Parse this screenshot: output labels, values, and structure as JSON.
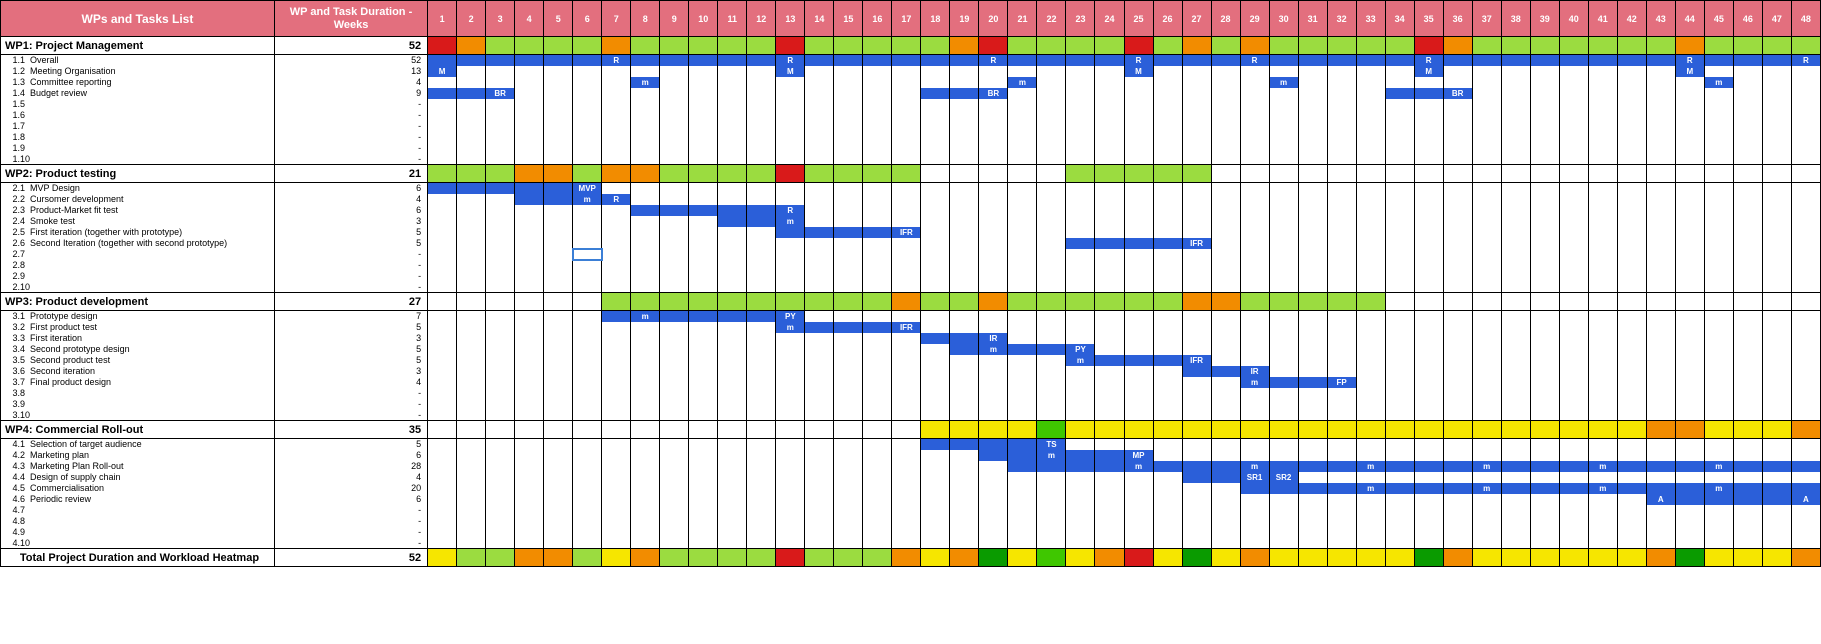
{
  "headers": {
    "col1": "WPs and Tasks List",
    "col2": "WP and Task Duration - Weeks"
  },
  "weeks": 48,
  "wp_headers": [
    {
      "id": "WP1",
      "title": "WP1:    Project Management",
      "dur": "52",
      "heat": [
        "red",
        "orange",
        "lgreen",
        "lgreen",
        "lgreen",
        "lgreen",
        "orange",
        "lgreen",
        "lgreen",
        "lgreen",
        "lgreen",
        "lgreen",
        "red",
        "lgreen",
        "lgreen",
        "lgreen",
        "lgreen",
        "lgreen",
        "orange",
        "red",
        "lgreen",
        "lgreen",
        "lgreen",
        "lgreen",
        "red",
        "lgreen",
        "orange",
        "lgreen",
        "orange",
        "lgreen",
        "lgreen",
        "lgreen",
        "lgreen",
        "lgreen",
        "red",
        "orange",
        "lgreen",
        "lgreen",
        "lgreen",
        "lgreen",
        "lgreen",
        "lgreen",
        "lgreen",
        "orange",
        "lgreen",
        "lgreen",
        "lgreen",
        "lgreen"
      ]
    },
    {
      "id": "WP2",
      "title": "WP2:    Product testing",
      "dur": "21",
      "heat": [
        "lgreen",
        "lgreen",
        "lgreen",
        "orange",
        "orange",
        "lgreen",
        "orange",
        "orange",
        "lgreen",
        "lgreen",
        "lgreen",
        "lgreen",
        "red",
        "lgreen",
        "lgreen",
        "lgreen",
        "lgreen",
        "",
        "",
        "",
        "",
        "",
        "lgreen",
        "lgreen",
        "lgreen",
        "lgreen",
        "lgreen",
        "",
        "",
        "",
        "",
        "",
        "",
        "",
        "",
        "",
        "",
        "",
        "",
        "",
        "",
        "",
        "",
        "",
        "",
        "",
        "",
        ""
      ]
    },
    {
      "id": "WP3",
      "title": "WP3:    Product development",
      "dur": "27",
      "heat": [
        "",
        "",
        "",
        "",
        "",
        "",
        "lgreen",
        "lgreen",
        "lgreen",
        "lgreen",
        "lgreen",
        "lgreen",
        "lgreen",
        "lgreen",
        "lgreen",
        "lgreen",
        "orange",
        "lgreen",
        "lgreen",
        "orange",
        "lgreen",
        "lgreen",
        "lgreen",
        "lgreen",
        "lgreen",
        "lgreen",
        "orange",
        "orange",
        "lgreen",
        "lgreen",
        "lgreen",
        "lgreen",
        "lgreen",
        "",
        "",
        "",
        "",
        "",
        "",
        "",
        "",
        "",
        "",
        "",
        "",
        "",
        "",
        ""
      ]
    },
    {
      "id": "WP4",
      "title": "WP4:    Commercial Roll-out",
      "dur": "35",
      "heat": [
        "",
        "",
        "",
        "",
        "",
        "",
        "",
        "",
        "",
        "",
        "",
        "",
        "",
        "",
        "",
        "",
        "",
        "yellow",
        "yellow",
        "yellow",
        "yellow",
        "green",
        "yellow",
        "yellow",
        "yellow",
        "yellow",
        "yellow",
        "yellow",
        "yellow",
        "yellow",
        "yellow",
        "yellow",
        "yellow",
        "yellow",
        "yellow",
        "yellow",
        "yellow",
        "yellow",
        "yellow",
        "yellow",
        "yellow",
        "yellow",
        "orange",
        "orange",
        "yellow",
        "yellow",
        "yellow",
        "orange"
      ]
    }
  ],
  "chart_data": {
    "type": "gantt-heatmap",
    "title": "Project Plan Gantt with Workload Heatmap",
    "xlabel": "Weeks",
    "x_range": [
      1,
      48
    ],
    "total_row": {
      "label": "Total Project Duration and Workload Heatmap",
      "dur": "52",
      "heat": [
        "yellow",
        "lgreen",
        "lgreen",
        "orange",
        "orange",
        "lgreen",
        "yellow",
        "orange",
        "lgreen",
        "lgreen",
        "lgreen",
        "lgreen",
        "red",
        "lgreen",
        "lgreen",
        "lgreen",
        "orange",
        "yellow",
        "orange",
        "bgreen",
        "yellow",
        "green",
        "yellow",
        "orange",
        "red",
        "yellow",
        "bgreen",
        "yellow",
        "orange",
        "yellow",
        "yellow",
        "yellow",
        "yellow",
        "yellow",
        "bgreen",
        "orange",
        "yellow",
        "yellow",
        "yellow",
        "yellow",
        "yellow",
        "yellow",
        "orange",
        "bgreen",
        "yellow",
        "yellow",
        "yellow",
        "orange"
      ]
    },
    "tasks": [
      {
        "wp": "WP1",
        "id": "1.1",
        "name": "Overall",
        "dur": "52",
        "bars": [
          {
            "s": 1,
            "e": 48
          }
        ],
        "labels": {
          "7": "R",
          "13": "R",
          "20": "R",
          "25": "R",
          "29": "R",
          "35": "R",
          "44": "R",
          "48": "R"
        }
      },
      {
        "wp": "WP1",
        "id": "1.2",
        "name": "Meeting Organisation",
        "dur": "13",
        "bars": [
          {
            "s": 1,
            "e": 1
          },
          {
            "s": 13,
            "e": 13
          },
          {
            "s": 25,
            "e": 25
          },
          {
            "s": 35,
            "e": 35
          },
          {
            "s": 44,
            "e": 44
          }
        ],
        "labels": {
          "1": "M",
          "13": "M",
          "25": "M",
          "35": "M",
          "44": "M"
        }
      },
      {
        "wp": "WP1",
        "id": "1.3",
        "name": "Committee reporting",
        "dur": "4",
        "bars": [
          {
            "s": 8,
            "e": 8
          },
          {
            "s": 21,
            "e": 21
          },
          {
            "s": 30,
            "e": 30
          },
          {
            "s": 45,
            "e": 45
          }
        ],
        "labels": {
          "8": "m",
          "21": "m",
          "30": "m",
          "45": "m"
        }
      },
      {
        "wp": "WP1",
        "id": "1.4",
        "name": "Budget review",
        "dur": "9",
        "bars": [
          {
            "s": 1,
            "e": 3
          },
          {
            "s": 18,
            "e": 20
          },
          {
            "s": 34,
            "e": 36
          }
        ],
        "labels": {
          "3": "BR",
          "20": "BR",
          "36": "BR"
        }
      },
      {
        "wp": "WP1",
        "id": "1.5",
        "name": "",
        "dur": "-"
      },
      {
        "wp": "WP1",
        "id": "1.6",
        "name": "",
        "dur": "-"
      },
      {
        "wp": "WP1",
        "id": "1.7",
        "name": "",
        "dur": "-"
      },
      {
        "wp": "WP1",
        "id": "1.8",
        "name": "",
        "dur": "-"
      },
      {
        "wp": "WP1",
        "id": "1.9",
        "name": "",
        "dur": "-"
      },
      {
        "wp": "WP1",
        "id": "1.10",
        "name": "",
        "dur": "-"
      },
      {
        "wp": "WP2",
        "id": "2.1",
        "name": "MVP Design",
        "dur": "6",
        "bars": [
          {
            "s": 1,
            "e": 6
          }
        ],
        "labels": {
          "6": "MVP"
        }
      },
      {
        "wp": "WP2",
        "id": "2.2",
        "name": "Cursomer development",
        "dur": "4",
        "bars": [
          {
            "s": 4,
            "e": 7
          }
        ],
        "labels": {
          "6": "m",
          "7": "R"
        }
      },
      {
        "wp": "WP2",
        "id": "2.3",
        "name": "Product-Market fit test",
        "dur": "6",
        "bars": [
          {
            "s": 8,
            "e": 13
          }
        ],
        "labels": {
          "13": "R"
        }
      },
      {
        "wp": "WP2",
        "id": "2.4",
        "name": "Smoke test",
        "dur": "3",
        "bars": [
          {
            "s": 11,
            "e": 13
          }
        ],
        "labels": {
          "13": "m"
        }
      },
      {
        "wp": "WP2",
        "id": "2.5",
        "name": "First iteration (together with prototype)",
        "dur": "5",
        "bars": [
          {
            "s": 13,
            "e": 17
          }
        ],
        "labels": {
          "17": "IFR"
        }
      },
      {
        "wp": "WP2",
        "id": "2.6",
        "name": "Second Iteration (together with second prototype)",
        "dur": "5",
        "bars": [
          {
            "s": 23,
            "e": 27
          }
        ],
        "labels": {
          "27": "IFR"
        }
      },
      {
        "wp": "WP2",
        "id": "2.7",
        "name": "",
        "dur": "-",
        "selected_cell": 6
      },
      {
        "wp": "WP2",
        "id": "2.8",
        "name": "",
        "dur": "-"
      },
      {
        "wp": "WP2",
        "id": "2.9",
        "name": "",
        "dur": "-"
      },
      {
        "wp": "WP2",
        "id": "2.10",
        "name": "",
        "dur": "-"
      },
      {
        "wp": "WP3",
        "id": "3.1",
        "name": "Prototype design",
        "dur": "7",
        "bars": [
          {
            "s": 7,
            "e": 13
          }
        ],
        "labels": {
          "8": "m",
          "13": "PY"
        }
      },
      {
        "wp": "WP3",
        "id": "3.2",
        "name": "First product test",
        "dur": "5",
        "bars": [
          {
            "s": 13,
            "e": 17
          }
        ],
        "labels": {
          "13": "m",
          "17": "IFR"
        }
      },
      {
        "wp": "WP3",
        "id": "3.3",
        "name": "First iteration",
        "dur": "3",
        "bars": [
          {
            "s": 18,
            "e": 20
          }
        ],
        "labels": {
          "20": "IR"
        }
      },
      {
        "wp": "WP3",
        "id": "3.4",
        "name": "Second prototype design",
        "dur": "5",
        "bars": [
          {
            "s": 19,
            "e": 23
          }
        ],
        "labels": {
          "20": "m",
          "23": "PY"
        }
      },
      {
        "wp": "WP3",
        "id": "3.5",
        "name": "Second product test",
        "dur": "5",
        "bars": [
          {
            "s": 23,
            "e": 27
          }
        ],
        "labels": {
          "23": "m",
          "27": "IFR"
        }
      },
      {
        "wp": "WP3",
        "id": "3.6",
        "name": "Second iteration",
        "dur": "3",
        "bars": [
          {
            "s": 27,
            "e": 29
          }
        ],
        "labels": {
          "29": "IR"
        }
      },
      {
        "wp": "WP3",
        "id": "3.7",
        "name": "Final product design",
        "dur": "4",
        "bars": [
          {
            "s": 29,
            "e": 32
          }
        ],
        "labels": {
          "29": "m",
          "32": "FP"
        }
      },
      {
        "wp": "WP3",
        "id": "3.8",
        "name": "",
        "dur": "-"
      },
      {
        "wp": "WP3",
        "id": "3.9",
        "name": "",
        "dur": "-"
      },
      {
        "wp": "WP3",
        "id": "3.10",
        "name": "",
        "dur": "-"
      },
      {
        "wp": "WP4",
        "id": "4.1",
        "name": "Selection of target audience",
        "dur": "5",
        "bars": [
          {
            "s": 18,
            "e": 22
          }
        ],
        "labels": {
          "22": "TS"
        }
      },
      {
        "wp": "WP4",
        "id": "4.2",
        "name": "Marketing plan",
        "dur": "6",
        "bars": [
          {
            "s": 20,
            "e": 25
          }
        ],
        "labels": {
          "22": "m",
          "25": "MP"
        }
      },
      {
        "wp": "WP4",
        "id": "4.3",
        "name": "Marketing Plan Roll-out",
        "dur": "28",
        "bars": [
          {
            "s": 21,
            "e": 48
          }
        ],
        "labels": {
          "25": "m",
          "29": "m",
          "33": "m",
          "37": "m",
          "41": "m",
          "45": "m"
        }
      },
      {
        "wp": "WP4",
        "id": "4.4",
        "name": "Design of supply chain",
        "dur": "4",
        "bars": [
          {
            "s": 27,
            "e": 30
          }
        ],
        "labels": {
          "29": "SR1",
          "30": "SR2"
        }
      },
      {
        "wp": "WP4",
        "id": "4.5",
        "name": "Commercialisation",
        "dur": "20",
        "bars": [
          {
            "s": 29,
            "e": 48
          }
        ],
        "labels": {
          "33": "m",
          "37": "m",
          "41": "m",
          "45": "m"
        }
      },
      {
        "wp": "WP4",
        "id": "4.6",
        "name": "Periodic review",
        "dur": "6",
        "bars": [
          {
            "s": 43,
            "e": 48
          }
        ],
        "labels": {
          "43": "A",
          "48": "A"
        }
      },
      {
        "wp": "WP4",
        "id": "4.7",
        "name": "",
        "dur": "-"
      },
      {
        "wp": "WP4",
        "id": "4.8",
        "name": "",
        "dur": "-"
      },
      {
        "wp": "WP4",
        "id": "4.9",
        "name": "",
        "dur": "-"
      },
      {
        "wp": "WP4",
        "id": "4.10",
        "name": "",
        "dur": "-"
      }
    ]
  }
}
